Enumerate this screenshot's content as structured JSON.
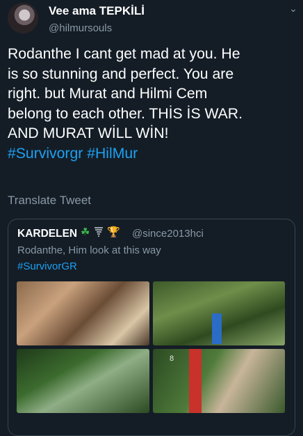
{
  "tweet": {
    "display_name": "Vee ama TEPKİLİ",
    "handle": "@hilmursouls",
    "text_lines": [
      "Rodanthe I cant get mad at you. He",
      "is so stunning and perfect. You are",
      "right. but  Murat and Hilmi Cem",
      "belong to each other. THİS İS WAR.",
      "AND MURAT WİLL WİN!"
    ],
    "hashtags": [
      "#Survivorgr",
      "#HilMur"
    ],
    "translate_label": "Translate Tweet",
    "menu_icon": "chevron-down-icon"
  },
  "quoted_tweet": {
    "display_name": "KARDELEN",
    "emojis": [
      "☘",
      "🏆"
    ],
    "handle": "@since2013hci",
    "text": "Rodanthe,  Him look at this way",
    "hashtag": "#SurvivorGR",
    "photos": [
      {
        "icon": "image-icon"
      },
      {
        "icon": "image-icon",
        "overlay_text": ""
      },
      {
        "icon": "image-icon"
      },
      {
        "icon": "image-icon",
        "overlay_text": "8"
      }
    ]
  },
  "colors": {
    "background": "#141d26",
    "text": "#ffffff",
    "secondary_text": "#8899a6",
    "link": "#1da1f2",
    "border": "#38444d"
  }
}
